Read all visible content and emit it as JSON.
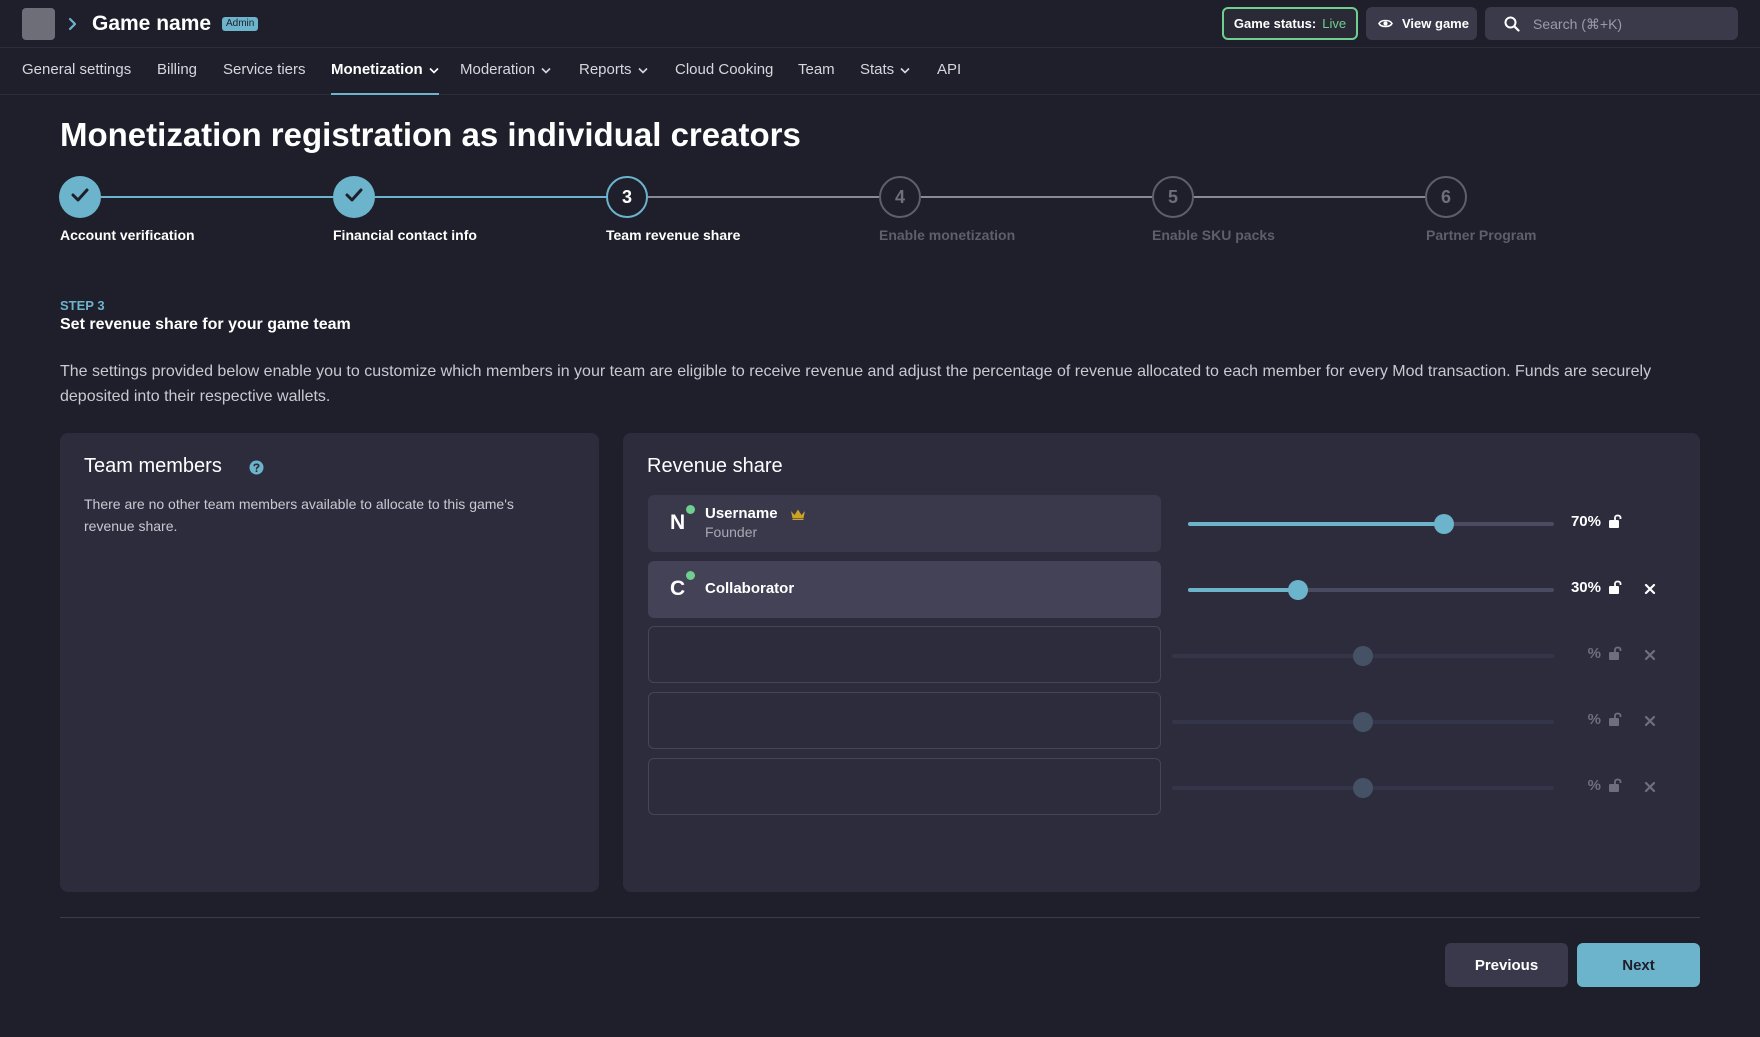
{
  "header": {
    "game_name": "Game name",
    "role_badge": "Admin",
    "status_label": "Game status:",
    "status_value": "Live",
    "view_game_label": "View game",
    "search_placeholder": "Search (⌘+K)"
  },
  "nav": {
    "items": [
      {
        "label": "General settings",
        "dropdown": false,
        "active": false
      },
      {
        "label": "Billing",
        "dropdown": false,
        "active": false
      },
      {
        "label": "Service tiers",
        "dropdown": false,
        "active": false
      },
      {
        "label": "Monetization",
        "dropdown": true,
        "active": true
      },
      {
        "label": "Moderation",
        "dropdown": true,
        "active": false
      },
      {
        "label": "Reports",
        "dropdown": true,
        "active": false
      },
      {
        "label": "Cloud Cooking",
        "dropdown": false,
        "active": false
      },
      {
        "label": "Team",
        "dropdown": false,
        "active": false
      },
      {
        "label": "Stats",
        "dropdown": true,
        "active": false
      },
      {
        "label": "API",
        "dropdown": false,
        "active": false
      }
    ]
  },
  "page": {
    "title": "Monetization registration as individual creators"
  },
  "stepper": {
    "steps": [
      {
        "number": "1",
        "label": "Account verification",
        "state": "done"
      },
      {
        "number": "2",
        "label": "Financial contact info",
        "state": "done"
      },
      {
        "number": "3",
        "label": "Team revenue share",
        "state": "current"
      },
      {
        "number": "4",
        "label": "Enable monetization",
        "state": "future"
      },
      {
        "number": "5",
        "label": "Enable SKU packs",
        "state": "future"
      },
      {
        "number": "6",
        "label": "Partner Program",
        "state": "future"
      }
    ]
  },
  "step": {
    "kicker": "STEP 3",
    "heading": "Set revenue share for your game team",
    "description": "The settings provided below enable you to customize which members in your team are eligible to receive revenue and adjust the percentage of revenue allocated to each member for every Mod transaction. Funds are securely deposited into their respective wallets."
  },
  "team_members": {
    "title": "Team members",
    "empty_text": "There are no other team members available to allocate to this game's revenue share."
  },
  "revenue_share": {
    "title": "Revenue share",
    "rows": [
      {
        "initial": "N",
        "name": "Username",
        "role": "Founder",
        "online": true,
        "owner": true,
        "share": 70,
        "share_label": "70%",
        "removable": false
      },
      {
        "initial": "C",
        "name": "Collaborator",
        "role": "",
        "online": true,
        "owner": false,
        "share": 30,
        "share_label": "30%",
        "removable": true
      },
      {
        "initial": "",
        "name": "",
        "role": "",
        "online": false,
        "owner": false,
        "share": 50,
        "share_label": "%",
        "removable": true
      },
      {
        "initial": "",
        "name": "",
        "role": "",
        "online": false,
        "owner": false,
        "share": 50,
        "share_label": "%",
        "removable": true
      },
      {
        "initial": "",
        "name": "",
        "role": "",
        "online": false,
        "owner": false,
        "share": 50,
        "share_label": "%",
        "removable": true
      }
    ]
  },
  "footer": {
    "previous_label": "Previous",
    "next_label": "Next"
  },
  "colors": {
    "background": "#1f1f2b",
    "accent": "#6cb3cc",
    "live": "#6fcf8f",
    "card": "#2d2c3c"
  },
  "icons": {
    "breadcrumb": "chevron-right-icon",
    "view_game": "eye-icon",
    "search": "search-icon",
    "dropdown": "chevron-down-icon",
    "step_done": "check-icon",
    "help": "help-icon",
    "owner": "crown-icon",
    "lock": "unlock-icon",
    "remove": "close-icon"
  }
}
